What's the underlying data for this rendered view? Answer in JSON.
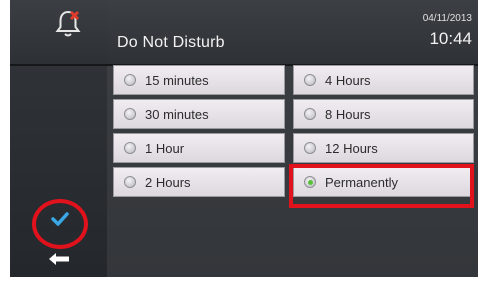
{
  "header": {
    "title": "Do Not Disturb",
    "date": "04/11/2013",
    "time": "10:44",
    "bell_icon": "bell-muted-icon"
  },
  "options": [
    {
      "label": "15 minutes",
      "selected": false
    },
    {
      "label": "30 minutes",
      "selected": false
    },
    {
      "label": "1 Hour",
      "selected": false
    },
    {
      "label": "2 Hours",
      "selected": false
    },
    {
      "label": "4 Hours",
      "selected": false
    },
    {
      "label": "8 Hours",
      "selected": false
    },
    {
      "label": "12 Hours",
      "selected": false
    },
    {
      "label": "Permanently",
      "selected": true
    }
  ],
  "rail": {
    "confirm_icon": "checkmark-icon",
    "back_icon": "back-arrow-icon"
  },
  "colors": {
    "highlight": "#e1121c",
    "selected_radio": "#56c23a",
    "check": "#3aa7e6"
  }
}
